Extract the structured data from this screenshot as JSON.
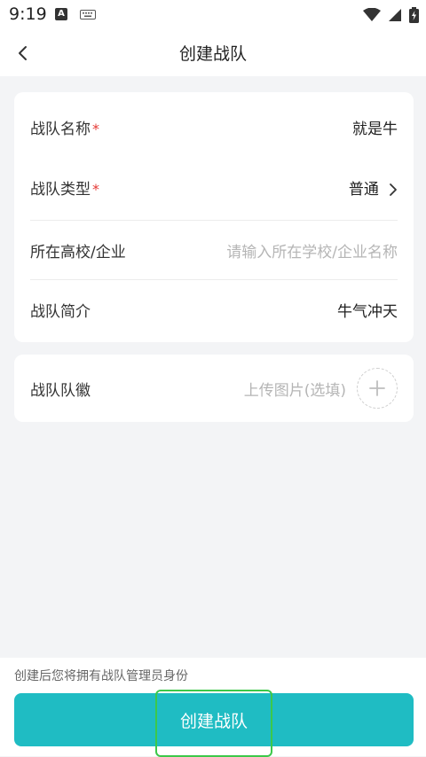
{
  "status_bar": {
    "time": "9:19",
    "a_label": "A"
  },
  "header": {
    "title": "创建战队"
  },
  "form": {
    "team_name": {
      "label": "战队名称",
      "required_mark": "*",
      "value": "就是牛"
    },
    "team_type": {
      "label": "战队类型",
      "required_mark": "*",
      "value": "普通"
    },
    "school": {
      "label": "所在高校/企业",
      "placeholder": "请输入所在学校/企业名称"
    },
    "intro": {
      "label": "战队简介",
      "value": "牛气冲天"
    },
    "badge": {
      "label": "战队队徽",
      "placeholder": "上传图片(选填)"
    }
  },
  "footer": {
    "note": "创建后您将拥有战队管理员身份",
    "create_label": "创建战队"
  },
  "colors": {
    "accent": "#1fbcc3",
    "required": "#e53935",
    "focus": "#3cc84a"
  }
}
